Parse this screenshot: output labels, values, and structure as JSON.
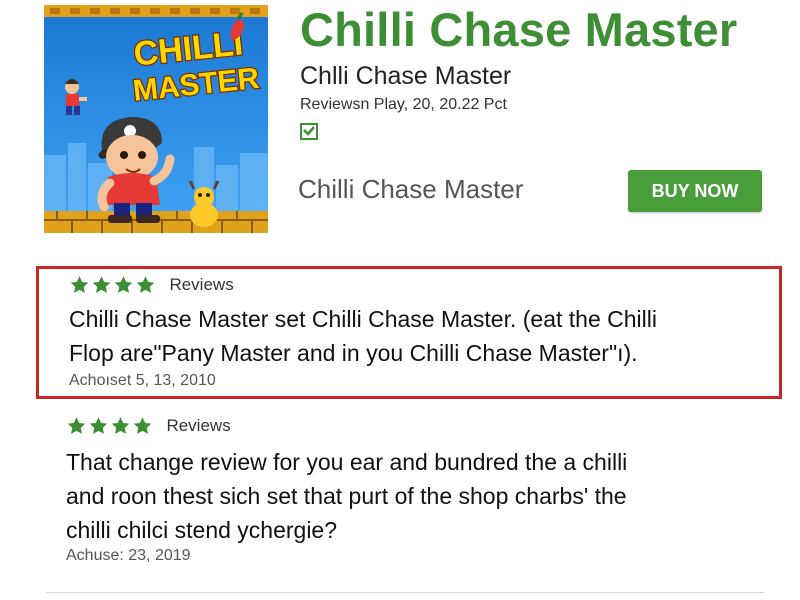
{
  "app": {
    "icon": {
      "logo_line1": "CHILLI",
      "logo_line2": "MASTER",
      "name": "app-icon-artwork",
      "background": "#1e88e5"
    },
    "title": "Chilli Chase Master",
    "subtitle": "Chlli Chase Master",
    "meta": "Reviewsn Play, 20, 20.22 Pct",
    "badge_icon": "check-box-icon",
    "name_line": "Chilli Chase Master",
    "buy_label": "BUY NOW",
    "accent_color": "#3e8e35",
    "button_color": "#4a9d3b"
  },
  "reviews": [
    {
      "stars": 4,
      "star_icon": "star-icon",
      "label": "Reviews",
      "lines": [
        "Chilli Chase Master set Chilli Chase Master. (eat the Chilli",
        "Flop are\"Pany Master and in you Chilli Chase Master\"ı)."
      ],
      "date": "Achoıset 5, 13, 2010",
      "highlighted": true,
      "highlight_color": "#c62828"
    },
    {
      "stars": 4,
      "star_icon": "star-icon",
      "label": "Reviews",
      "lines": [
        "That change review for you ear and bundred the a chilli",
        "and roon thest sich set that purt of the shop charbs' the",
        "chilli chilci stend ychergie?"
      ],
      "date": "Achuse: 23, 2019",
      "highlighted": false
    }
  ]
}
